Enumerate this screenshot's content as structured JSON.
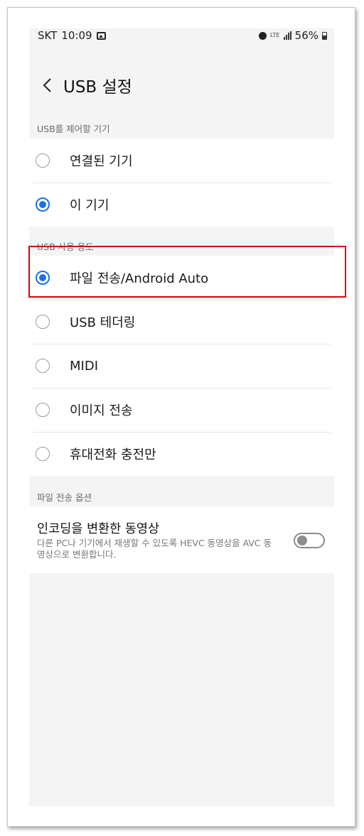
{
  "status_bar": {
    "carrier": "SKT",
    "time": "10:09",
    "network": "LTE",
    "battery": "56%",
    "icons": [
      "gallery-icon",
      "alarm-icon",
      "lte-icon",
      "signal-icon",
      "battery-icon"
    ]
  },
  "header": {
    "back_icon": "chevron-left-icon",
    "title": "USB 설정"
  },
  "control_section": {
    "label": "USB를 제어할 기기",
    "options": [
      {
        "label": "연결된 기기",
        "selected": false
      },
      {
        "label": "이 기기",
        "selected": true
      }
    ]
  },
  "usage_section": {
    "label": "USB 사용 용도",
    "options": [
      {
        "label": "파일 전송/Android Auto",
        "selected": true
      },
      {
        "label": "USB 테더링",
        "selected": false
      },
      {
        "label": "MIDI",
        "selected": false
      },
      {
        "label": "이미지 전송",
        "selected": false
      },
      {
        "label": "휴대전화 충전만",
        "selected": false
      }
    ]
  },
  "file_transfer_section": {
    "label": "파일 전송 옵션",
    "toggle": {
      "title": "인코딩을 변환한 동영상",
      "description": "다른 PC나 기기에서 재생할 수 있도록 HEVC 동영상을 AVC 동영상으로 변환합니다.",
      "enabled": false
    }
  },
  "colors": {
    "accent": "#1a73e8",
    "highlight": "#dd0000",
    "background": "#f4f4f4"
  }
}
